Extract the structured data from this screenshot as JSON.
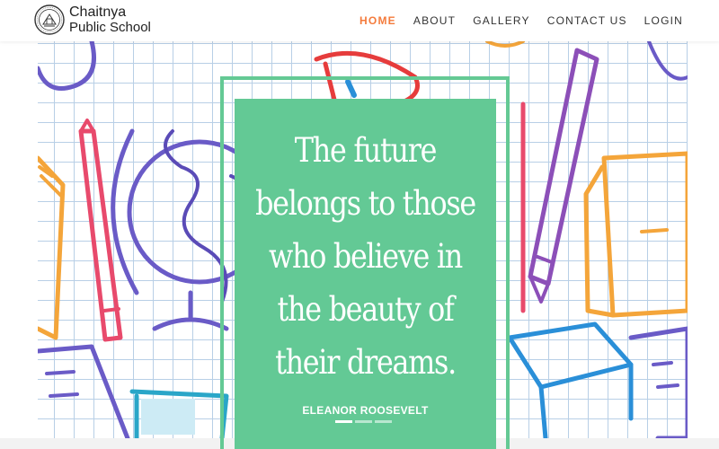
{
  "brand": {
    "line1": "Chaitnya",
    "line2": "Public School"
  },
  "nav": [
    {
      "label": "HOME",
      "active": true
    },
    {
      "label": "ABOUT",
      "active": false
    },
    {
      "label": "GALLERY",
      "active": false
    },
    {
      "label": "CONTACT US",
      "active": false
    },
    {
      "label": "LOGIN",
      "active": false
    }
  ],
  "hero": {
    "quote_lines": [
      "The future",
      "belongs to those",
      "who believe in",
      "the beauty of",
      "their dreams."
    ],
    "author": "ELEANOR ROOSEVELT",
    "slide_count": 3,
    "active_slide": 1
  },
  "colors": {
    "accent": "#f47b3c",
    "card": "#63c995",
    "grid": "#b8cfe6"
  }
}
